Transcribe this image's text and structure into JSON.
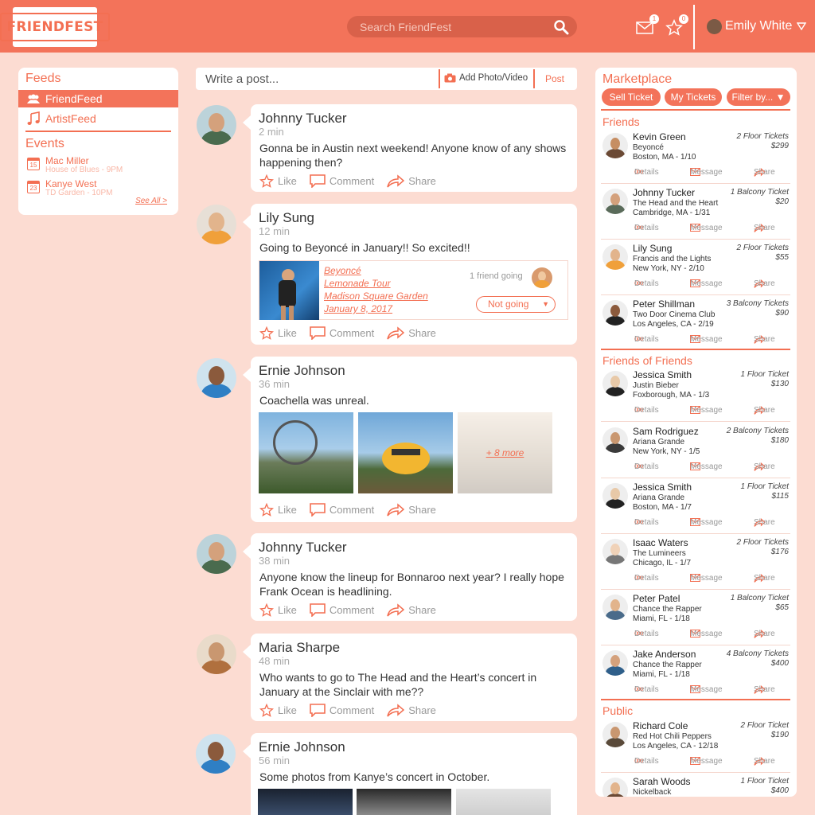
{
  "header": {
    "logo": "FRIENDFEST",
    "search_placeholder": "Search FriendFest",
    "messages_badge": "1",
    "favorites_badge": "0",
    "user_name": "Emily White"
  },
  "sidebar": {
    "feeds_title": "Feeds",
    "feeds": [
      {
        "label": "FriendFeed",
        "icon": "people-icon"
      },
      {
        "label": "ArtistFeed",
        "icon": "music-note-icon"
      }
    ],
    "events_title": "Events",
    "events": [
      {
        "day": "15",
        "title": "Mac Miller",
        "sub": "House of Blues - 9PM"
      },
      {
        "day": "23",
        "title": "Kanye West",
        "sub": "TD Garden - 10PM"
      }
    ],
    "see_all": "See All >"
  },
  "composer": {
    "placeholder": "Write a post...",
    "add_photo": "Add Photo/Video",
    "post": "Post"
  },
  "actions": {
    "like": "Like",
    "comment": "Comment",
    "share": "Share"
  },
  "posts": [
    {
      "name": "Johnny Tucker",
      "time": "2 min",
      "text": "Gonna be in Austin next weekend! Anyone know of any shows happening then?"
    },
    {
      "name": "Lily Sung",
      "time": "12 min",
      "text": "Going to Beyoncé in January!! So excited!!",
      "event": {
        "l1": "Beyoncé",
        "l2": "Lemonade Tour",
        "l3": "Madison Square Garden",
        "l4": "January 8, 2017",
        "friends": "1 friend going",
        "status": "Not going"
      }
    },
    {
      "name": "Ernie Johnson",
      "time": "36 min",
      "text": "Coachella was unreal.",
      "more": "+ 8 more"
    },
    {
      "name": "Johnny Tucker",
      "time": "38 min",
      "text": "Anyone know the lineup for Bonnaroo next year? I really hope Frank Ocean is headlining."
    },
    {
      "name": "Maria Sharpe",
      "time": "48 min",
      "text": "Who wants to go to The Head and the Heart’s concert in January at the Sinclair with me??"
    },
    {
      "name": "Ernie Johnson",
      "time": "56 min",
      "text": "Some photos from Kanye’s concert in October."
    }
  ],
  "market": {
    "title": "Marketplace",
    "sell": "Sell Ticket",
    "mine": "My Tickets",
    "filter": "Filter by...",
    "details": "Details",
    "message": "Message",
    "share": "Share",
    "groups": [
      "Friends",
      "Friends of Friends",
      "Public"
    ],
    "tickets": [
      {
        "name": "Kevin Green",
        "artist": "Beyoncé",
        "loc": "Boston, MA - 1/10",
        "qty": "2 Floor Tickets",
        "price": "$299"
      },
      {
        "name": "Johnny Tucker",
        "artist": "The Head and the Heart",
        "loc": "Cambridge, MA - 1/31",
        "qty": "1 Balcony Ticket",
        "price": "$20"
      },
      {
        "name": "Lily Sung",
        "artist": "Francis and the Lights",
        "loc": "New York, NY - 2/10",
        "qty": "2 Floor Tickets",
        "price": "$55"
      },
      {
        "name": "Peter Shillman",
        "artist": "Two Door Cinema Club",
        "loc": "Los Angeles, CA - 2/19",
        "qty": "3 Balcony Tickets",
        "price": "$90"
      },
      {
        "name": "Jessica Smith",
        "artist": "Justin Bieber",
        "loc": "Foxborough, MA - 1/3",
        "qty": "1 Floor Ticket",
        "price": "$130"
      },
      {
        "name": "Sam Rodriguez",
        "artist": "Ariana Grande",
        "loc": "New York, NY - 1/5",
        "qty": "2 Balcony Tickets",
        "price": "$180"
      },
      {
        "name": "Jessica Smith",
        "artist": "Ariana Grande",
        "loc": "Boston, MA - 1/7",
        "qty": "1 Floor Ticket",
        "price": "$115"
      },
      {
        "name": "Isaac Waters",
        "artist": "The Lumineers",
        "loc": "Chicago, IL - 1/7",
        "qty": "2 Floor Tickets",
        "price": "$176"
      },
      {
        "name": "Peter Patel",
        "artist": "Chance the Rapper",
        "loc": "Miami, FL - 1/18",
        "qty": "1 Balcony Ticket",
        "price": "$65"
      },
      {
        "name": "Jake Anderson",
        "artist": "Chance the Rapper",
        "loc": "Miami, FL - 1/18",
        "qty": "4 Balcony Tickets",
        "price": "$400"
      },
      {
        "name": "Richard Cole",
        "artist": "Red Hot Chili Peppers",
        "loc": "Los Angeles, CA - 12/18",
        "qty": "2 Floor Ticket",
        "price": "$190"
      },
      {
        "name": "Sarah Woods",
        "artist": "Nickelback",
        "loc": "",
        "qty": "1 Floor Ticket",
        "price": "$400"
      }
    ]
  },
  "colors": {
    "accent": "#f3735a",
    "background": "#fcdcd2"
  }
}
